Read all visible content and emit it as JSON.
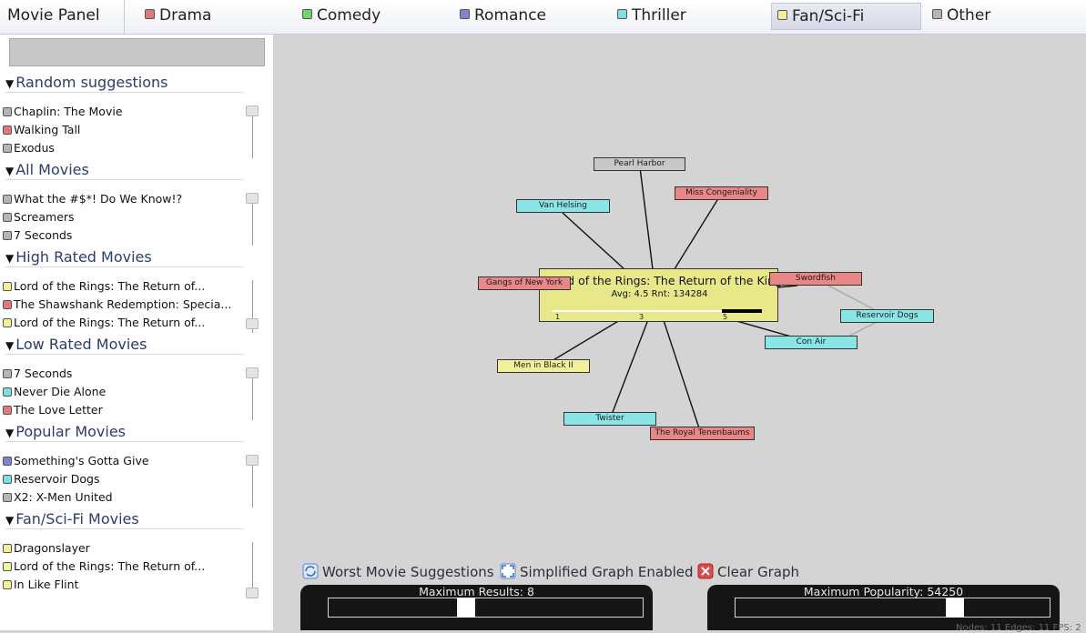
{
  "app_title": "Movie Panel",
  "categories": [
    {
      "label": "Drama",
      "color": "#e07a7a"
    },
    {
      "label": "Comedy",
      "color": "#6ed36e"
    },
    {
      "label": "Romance",
      "color": "#7f83d4"
    },
    {
      "label": "Thriller",
      "color": "#7ee0e0"
    },
    {
      "label": "Fan/Sci-Fi",
      "color": "#f1f19a",
      "selected": true
    },
    {
      "label": "Other",
      "color": "#b5b5b5"
    }
  ],
  "search": {
    "value": "",
    "placeholder": ""
  },
  "sections": [
    {
      "title": "Random suggestions",
      "items": [
        {
          "label": "Chaplin: The Movie",
          "category": "Other"
        },
        {
          "label": "Walking Tall",
          "category": "Drama"
        },
        {
          "label": "Exodus",
          "category": "Other"
        }
      ]
    },
    {
      "title": "All Movies",
      "items": [
        {
          "label": "What the #$*! Do We Know!?",
          "category": "Other"
        },
        {
          "label": "Screamers",
          "category": "Other"
        },
        {
          "label": "7 Seconds",
          "category": "Other"
        }
      ]
    },
    {
      "title": "High Rated Movies",
      "items": [
        {
          "label": "Lord of the Rings: The Return of...",
          "category": "Fan/Sci-Fi"
        },
        {
          "label": "The Shawshank Redemption: Specia...",
          "category": "Drama"
        },
        {
          "label": "Lord of the Rings: The Return of...",
          "category": "Fan/Sci-Fi"
        }
      ]
    },
    {
      "title": "Low Rated Movies",
      "items": [
        {
          "label": "7 Seconds",
          "category": "Other"
        },
        {
          "label": "Never Die Alone",
          "category": "Thriller"
        },
        {
          "label": "The Love Letter",
          "category": "Drama"
        }
      ]
    },
    {
      "title": "Popular Movies",
      "items": [
        {
          "label": "Something's Gotta Give",
          "category": "Romance"
        },
        {
          "label": "Reservoir Dogs",
          "category": "Thriller"
        },
        {
          "label": "X2: X-Men United",
          "category": "Other"
        }
      ]
    },
    {
      "title": "Fan/Sci-Fi Movies",
      "items": [
        {
          "label": "Dragonslayer",
          "category": "Fan/Sci-Fi"
        },
        {
          "label": "Lord of the Rings: The Return of...",
          "category": "Fan/Sci-Fi"
        },
        {
          "label": "In Like Flint",
          "category": "Fan/Sci-Fi"
        }
      ]
    }
  ],
  "graph": {
    "focus": {
      "title": "Lord of the Rings: The Return of the King",
      "stats": "Avg: 4.5 Rnt: 134284",
      "rating_scale": [
        "1",
        "3",
        "5"
      ],
      "rating": 4.5,
      "category": "Fan/Sci-Fi"
    },
    "nodes": [
      {
        "label": "Pearl Harbor",
        "category": "Other"
      },
      {
        "label": "Miss Congeniality",
        "category": "Drama"
      },
      {
        "label": "Van Helsing",
        "category": "Thriller"
      },
      {
        "label": "Gangs of New York",
        "category": "Drama"
      },
      {
        "label": "Swordfish",
        "category": "Drama"
      },
      {
        "label": "Reservoir Dogs",
        "category": "Thriller"
      },
      {
        "label": "Con Air",
        "category": "Thriller"
      },
      {
        "label": "Men in Black II",
        "category": "Fan/Sci-Fi"
      },
      {
        "label": "Twister",
        "category": "Thriller"
      },
      {
        "label": "The Royal Tenenbaums",
        "category": "Drama"
      }
    ]
  },
  "toolbar": {
    "worst_suggestions": "Worst Movie Suggestions",
    "simplified_graph": "Simplified Graph Enabled",
    "clear_graph": "Clear Graph"
  },
  "sliders": {
    "max_results": {
      "label": "Maximum Results: 8",
      "value": 8
    },
    "max_popularity": {
      "label": "Maximum Popularity: 54250",
      "value": 54250
    }
  },
  "status": "Nodes: 11 Edges: 11 FPS: 2"
}
